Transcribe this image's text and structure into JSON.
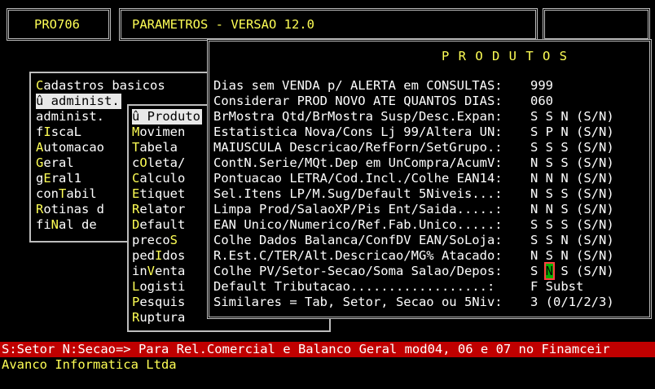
{
  "header": {
    "program_code": "PRO706",
    "title": "PARAMETROS - VERSAO 12.0"
  },
  "main_menu": {
    "items": [
      {
        "hotkey": "C",
        "rest": "adastros basicos"
      },
      {
        "prefix": "û ",
        "label": "administ.",
        "selected": true
      },
      {
        "label": "administ."
      },
      {
        "pre": "f",
        "hotkey": "I",
        "rest": "scaL"
      },
      {
        "hotkey": "A",
        "rest": "utomacao"
      },
      {
        "hotkey": "G",
        "rest": "eral"
      },
      {
        "pre": "g",
        "hotkey": "E",
        "rest": "ral1"
      },
      {
        "pre": "con",
        "hotkey": "T",
        "rest": "abil"
      },
      {
        "hotkey": "R",
        "rest": "otinas d"
      },
      {
        "pre": "fi",
        "hotkey": "N",
        "rest": "al de"
      }
    ]
  },
  "sub_menu": {
    "items": [
      {
        "prefix": "û ",
        "label": "Produto",
        "selected": true
      },
      {
        "hotkey": "M",
        "rest": "ovimen"
      },
      {
        "hotkey": "T",
        "rest": "abela"
      },
      {
        "pre": "c",
        "hotkey": "O",
        "rest": "leta/"
      },
      {
        "hotkey": "C",
        "rest": "alculo"
      },
      {
        "hotkey": "E",
        "rest": "tiquet"
      },
      {
        "hotkey": "R",
        "rest": "elator"
      },
      {
        "hotkey": "D",
        "rest": "efault"
      },
      {
        "pre": "preco",
        "hotkey": "S",
        "rest": ""
      },
      {
        "pre": "ped",
        "hotkey": "I",
        "rest": "dos"
      },
      {
        "pre": "in",
        "hotkey": "V",
        "rest": "enta"
      },
      {
        "hotkey": "L",
        "rest": "ogisti"
      },
      {
        "hotkey": "P",
        "rest": "esquis"
      },
      {
        "hotkey": "R",
        "rest": "uptura"
      }
    ]
  },
  "produtos_panel": {
    "title": "P R O D U T O S",
    "rows": [
      {
        "label": "Dias sem VENDA p/ ALERTA em CONSULTAS:",
        "value": "999"
      },
      {
        "label": "Considerar PROD NOVO ATE QUANTOS DIAS:",
        "value": "060"
      },
      {
        "label": "BrMostra Qtd/BrMostra Susp/Desc.Expan:",
        "value": "S S N (S/N)"
      },
      {
        "label": "Estatistica Nova/Cons Lj 99/Altera UN:",
        "value": "S P N (S/N)"
      },
      {
        "label": "MAIUSCULA Descricao/RefForn/SetGrupo.:",
        "value": "S S S (S/N)"
      },
      {
        "label": "ContN.Serie/MQt.Dep em UnCompra/AcumV:",
        "value": "N S S (S/N)"
      },
      {
        "label": "Pontuacao LETRA/Cod.Incl./Colhe EAN14:",
        "value": "N N N (S/N)"
      },
      {
        "label": "Sel.Itens LP/M.Sug/Default 5Niveis...:",
        "value": "N S S (S/N)"
      },
      {
        "label": "Limpa Prod/SalaoXP/Pis Ent/Saida.....:",
        "value": "N N S (S/N)"
      },
      {
        "label": "EAN Unico/Numerico/Ref.Fab.Unico.....:",
        "value": "S S S (S/N)"
      },
      {
        "label": "Colhe Dados Balanca/ConfDV EAN/SoLoja:",
        "value": "S S N (S/N)"
      },
      {
        "label": "R.Est.C/TER/Alt.Descricao/MG% Atacado:",
        "value": "N S N (S/N)"
      },
      {
        "label": "Colhe PV/Setor-Secao/Soma Salao/Depos:",
        "value_pre": "S ",
        "value_cursor": "N",
        "value_post": " S (S/N)"
      },
      {
        "label": "Default Tributacao..................:",
        "value": "F Subst"
      },
      {
        "label": "Similares = Tab, Setor, Secao ou 5Niv:",
        "value": "3 (0/1/2/3)"
      }
    ]
  },
  "status_bar": {
    "text": "S:Setor N:Secao=> Para Rel.Comercial e Balanco Geral mod04, 06 e 07 no Finamceir"
  },
  "footer": {
    "company": "Avanco Informatica Ltda"
  }
}
